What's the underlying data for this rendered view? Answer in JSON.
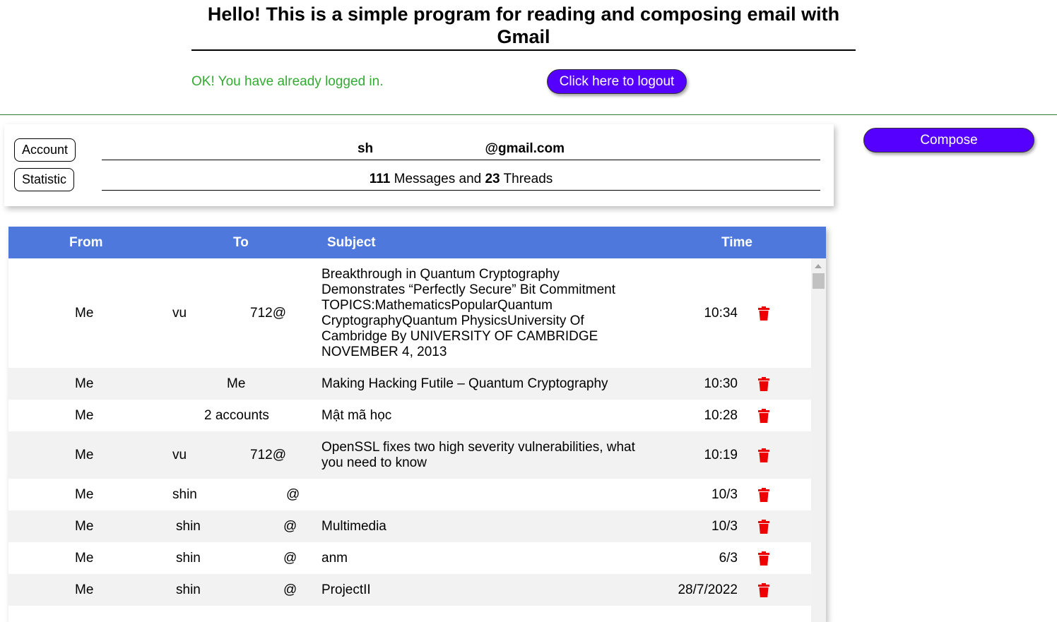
{
  "header": {
    "title": "Hello! This is a simple program for reading and composing email with Gmail"
  },
  "auth": {
    "status_text": "OK! You have already logged in.",
    "logout_label": "Click here to logout"
  },
  "info": {
    "account_label": "Account",
    "account_value": "sh                              @gmail.com",
    "statistic_label": "Statistic",
    "messages_count": "111",
    "messages_text": " Messages and ",
    "threads_count": "23",
    "threads_text": " Threads"
  },
  "compose": {
    "label": "Compose"
  },
  "table": {
    "columns": {
      "from": "From",
      "to": "To",
      "subject": "Subject",
      "time": "Time"
    },
    "rows": [
      {
        "from": "Me",
        "to_a": "vu",
        "to_b": "712@",
        "subject": "Breakthrough in Quantum Cryptography Demonstrates “Perfectly Secure” Bit Commitment TOPICS:MathematicsPopularQuantum CryptographyQuantum PhysicsUniversity Of Cambridge By UNIVERSITY OF CAMBRIDGE NOVEMBER 4, 2013",
        "time": "10:34"
      },
      {
        "from": "Me",
        "to_a": "",
        "to_b": "Me",
        "subject": "Making Hacking Futile – Quantum Cryptography",
        "time": "10:30"
      },
      {
        "from": "Me",
        "to_a": "",
        "to_b": "2 accounts",
        "subject": "Mật mã học",
        "time": "10:28"
      },
      {
        "from": "Me",
        "to_a": "vu",
        "to_b": "712@",
        "subject": "OpenSSL fixes two high severity vulnerabilities, what you need to know",
        "time": "10:19"
      },
      {
        "from": "Me",
        "to_a": "shin",
        "to_b": "@",
        "subject": "",
        "time": "10/3"
      },
      {
        "from": "Me",
        "to_a": "shin",
        "to_b": "@",
        "subject": "Multimedia",
        "time": "10/3"
      },
      {
        "from": "Me",
        "to_a": "shin",
        "to_b": "@",
        "subject": "anm",
        "time": "6/3"
      },
      {
        "from": "Me",
        "to_a": "shin",
        "to_b": "@",
        "subject": "ProjectII",
        "time": "28/7/2022"
      }
    ]
  },
  "colors": {
    "accent": "#5500ff",
    "table_header": "#4f78dd",
    "success_text": "#33aa33",
    "delete_icon": "#ee0000"
  },
  "icons": {
    "delete": "trash-icon"
  }
}
